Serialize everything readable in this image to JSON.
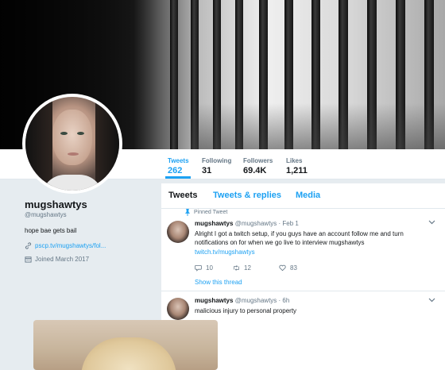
{
  "profile": {
    "name": "mugshawtys",
    "handle": "@mugshawtys",
    "bio": "hope bae gets bail",
    "link": "pscp.tv/mugshawtys/fol...",
    "joined": "Joined March 2017"
  },
  "nav": {
    "tweets_label": "Tweets",
    "tweets_value": "262",
    "following_label": "Following",
    "following_value": "31",
    "followers_label": "Followers",
    "followers_value": "69.4K",
    "likes_label": "Likes",
    "likes_value": "1,211"
  },
  "tabs": {
    "tweets": "Tweets",
    "replies": "Tweets & replies",
    "media": "Media"
  },
  "tweets": [
    {
      "pinned_label": "Pinned Tweet",
      "name": "mugshawtys",
      "meta": "@mugshawtys · Feb 1",
      "text": "Alright I got a twitch setup, if you guys have an account follow me and turn notifications on for when we go live to interview mugshawtys",
      "link": "twitch.tv/mugshawtys",
      "replies": "10",
      "retweets": "12",
      "likes": "83",
      "show_thread": "Show this thread"
    },
    {
      "name": "mugshawtys",
      "meta": "@mugshawtys · 6h",
      "text": "malicious injury to personal property"
    }
  ],
  "colors": {
    "accent": "#1da1f2",
    "background": "#e6ecf0",
    "text": "#14171a",
    "muted": "#657786"
  },
  "icons": {
    "pin": "pin-icon",
    "link": "link-icon",
    "calendar": "calendar-icon",
    "reply": "reply-icon",
    "retweet": "retweet-icon",
    "like": "heart-icon",
    "chevron": "chevron-down-icon"
  }
}
